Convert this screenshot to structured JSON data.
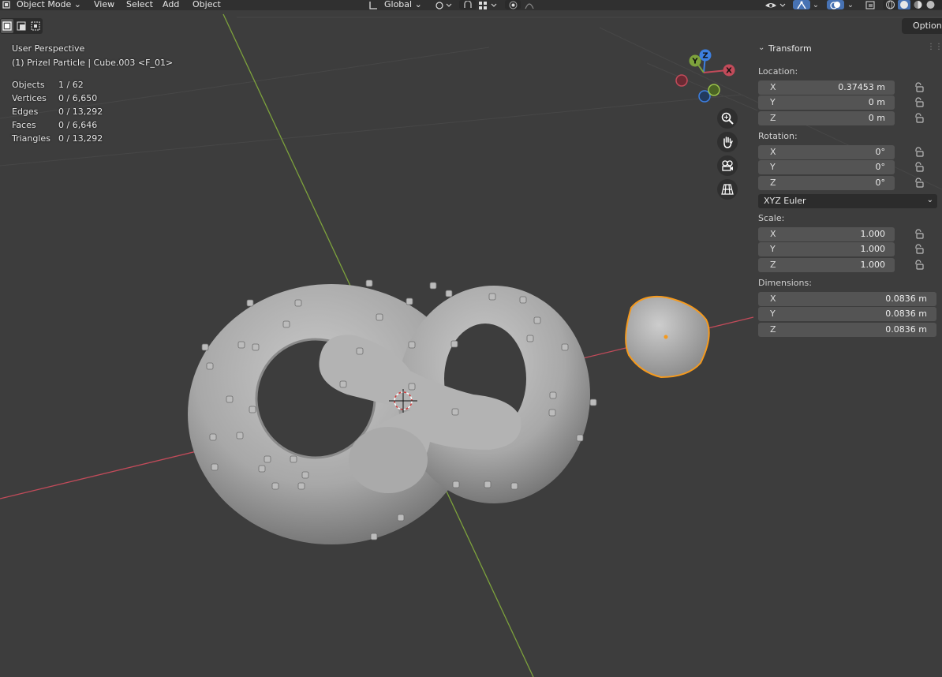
{
  "header": {
    "mode": "Object Mode",
    "menu": [
      "View",
      "Select",
      "Add",
      "Object"
    ],
    "transform_orientation": "Global"
  },
  "options_label": "Options",
  "viewport": {
    "view_name": "User Perspective",
    "active_object": "(1) Prizel Particle | Cube.003 <F_01>",
    "stats": [
      {
        "label": "Objects",
        "value": "1 / 62"
      },
      {
        "label": "Vertices",
        "value": "0 / 6,650"
      },
      {
        "label": "Edges",
        "value": "0 / 13,292"
      },
      {
        "label": "Faces",
        "value": "0 / 6,646"
      },
      {
        "label": "Triangles",
        "value": "0 / 13,292"
      }
    ],
    "gizmo": {
      "x": "X",
      "y": "Y",
      "z": "Z"
    }
  },
  "transform": {
    "title": "Transform",
    "location_label": "Location:",
    "location": [
      {
        "axis": "X",
        "value": "0.37453 m"
      },
      {
        "axis": "Y",
        "value": "0 m"
      },
      {
        "axis": "Z",
        "value": "0 m"
      }
    ],
    "rotation_label": "Rotation:",
    "rotation": [
      {
        "axis": "X",
        "value": "0°"
      },
      {
        "axis": "Y",
        "value": "0°"
      },
      {
        "axis": "Z",
        "value": "0°"
      }
    ],
    "rotation_mode": "XYZ Euler",
    "scale_label": "Scale:",
    "scale": [
      {
        "axis": "X",
        "value": "1.000"
      },
      {
        "axis": "Y",
        "value": "1.000"
      },
      {
        "axis": "Z",
        "value": "1.000"
      }
    ],
    "dimensions_label": "Dimensions:",
    "dimensions": [
      {
        "axis": "X",
        "value": "0.0836 m"
      },
      {
        "axis": "Y",
        "value": "0.0836 m"
      },
      {
        "axis": "Z",
        "value": "0.0836 m"
      }
    ]
  },
  "colors": {
    "viewport_bg": "#3d3d3d",
    "x_axis": "#c24b5a",
    "y_axis": "#7da23c",
    "z_axis": "#3d7fe0",
    "selection": "#f59a1e",
    "active_button": "#4772b3"
  }
}
